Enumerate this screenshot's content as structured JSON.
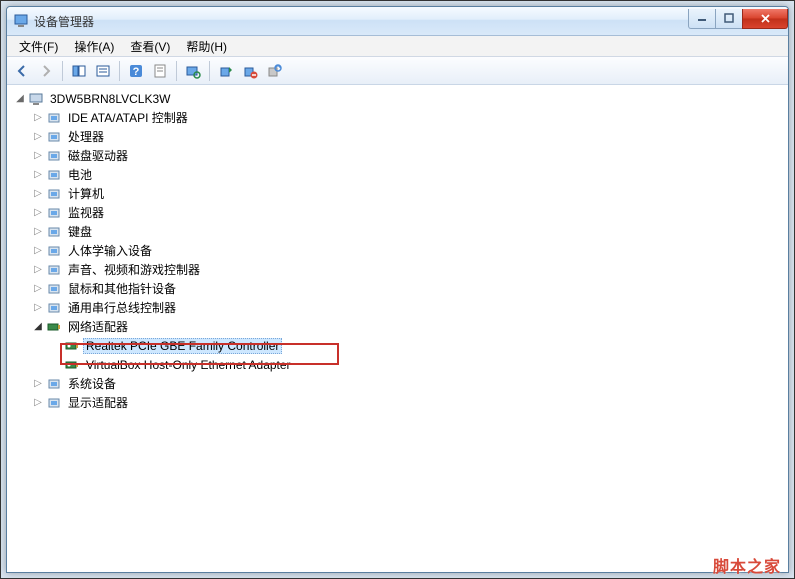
{
  "window": {
    "title": "设备管理器"
  },
  "menu": {
    "file": "文件(F)",
    "action": "操作(A)",
    "view": "查看(V)",
    "help": "帮助(H)"
  },
  "toolbar_icons": {
    "back": "back-arrow-icon",
    "forward": "forward-arrow-icon",
    "show": "show-pane-icon",
    "details": "details-icon",
    "help": "help-icon",
    "prop": "properties-icon",
    "scan": "scan-icon",
    "enable": "enable-icon",
    "disable": "disable-icon",
    "uninstall": "uninstall-icon"
  },
  "tree": {
    "root": "3DW5BRN8LVCLK3W",
    "items": [
      {
        "label": "IDE ATA/ATAPI 控制器",
        "expanded": false
      },
      {
        "label": "处理器",
        "expanded": false
      },
      {
        "label": "磁盘驱动器",
        "expanded": false
      },
      {
        "label": "电池",
        "expanded": false
      },
      {
        "label": "计算机",
        "expanded": false
      },
      {
        "label": "监视器",
        "expanded": false
      },
      {
        "label": "键盘",
        "expanded": false
      },
      {
        "label": "人体学输入设备",
        "expanded": false
      },
      {
        "label": "声音、视频和游戏控制器",
        "expanded": false
      },
      {
        "label": "鼠标和其他指针设备",
        "expanded": false
      },
      {
        "label": "通用串行总线控制器",
        "expanded": false
      },
      {
        "label": "网络适配器",
        "expanded": true,
        "children": [
          {
            "label": "Realtek PCIe GBE Family Controller",
            "selected": true
          },
          {
            "label": "VirtualBox Host-Only Ethernet Adapter",
            "selected": false
          }
        ]
      },
      {
        "label": "系统设备",
        "expanded": false
      },
      {
        "label": "显示适配器",
        "expanded": false
      }
    ]
  },
  "watermark": "脚本之家"
}
